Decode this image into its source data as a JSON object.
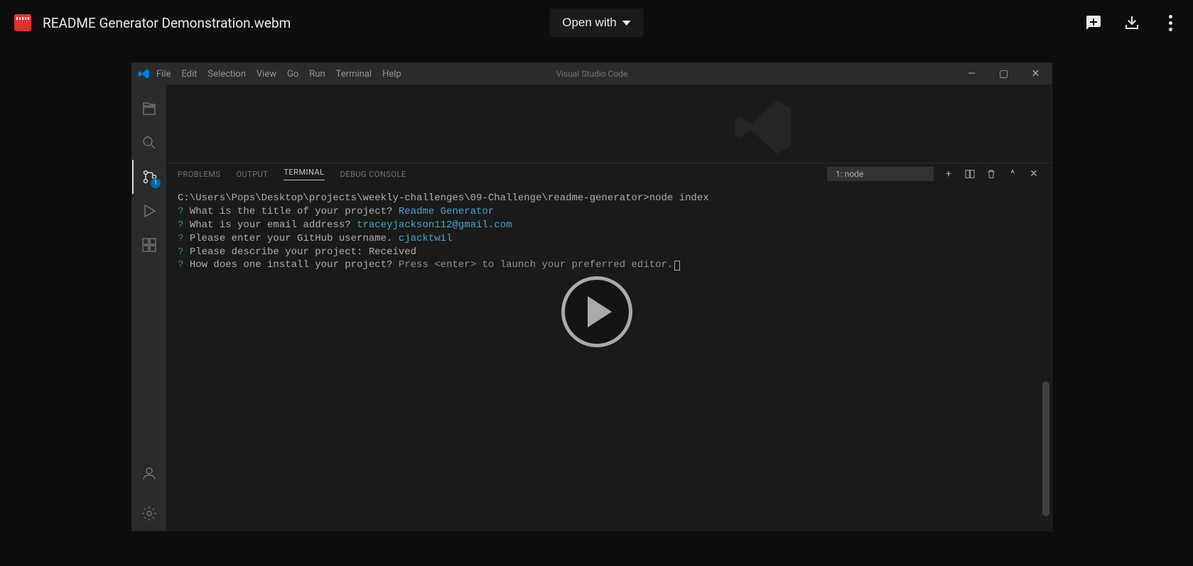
{
  "drive": {
    "filename": "README Generator Demonstration.webm",
    "open_with": "Open with"
  },
  "vscode": {
    "title": "Visual Studio Code",
    "menu": [
      "File",
      "Edit",
      "Selection",
      "View",
      "Go",
      "Run",
      "Terminal",
      "Help"
    ],
    "badge_count": "1",
    "panel_tabs": {
      "problems": "PROBLEMS",
      "output": "OUTPUT",
      "terminal": "TERMINAL",
      "debug": "DEBUG CONSOLE"
    },
    "terminal_selector": "1: node",
    "terminal": {
      "cwd_line": "C:\\Users\\Pops\\Desktop\\projects\\weekly-challenges\\09-Challenge\\readme-generator>node index",
      "lines": [
        {
          "marker": "?",
          "q": "What is the title of your project?",
          "a": "Readme Generator",
          "aStyle": "answer"
        },
        {
          "marker": "?",
          "q": "What is your email address?",
          "a": "traceyjackson112@gmail.com",
          "aStyle": "answer"
        },
        {
          "marker": "?",
          "q": "Please enter your GitHub username.",
          "a": "cjacktwil",
          "aStyle": "answer"
        },
        {
          "marker": "?",
          "q": "Please describe your project:",
          "a": "Received",
          "aStyle": "plain"
        },
        {
          "marker": "?",
          "q": "How does one install your project?",
          "a": "Press <enter> to launch your preferred editor.",
          "aStyle": "dim",
          "cursor": true
        }
      ]
    }
  }
}
